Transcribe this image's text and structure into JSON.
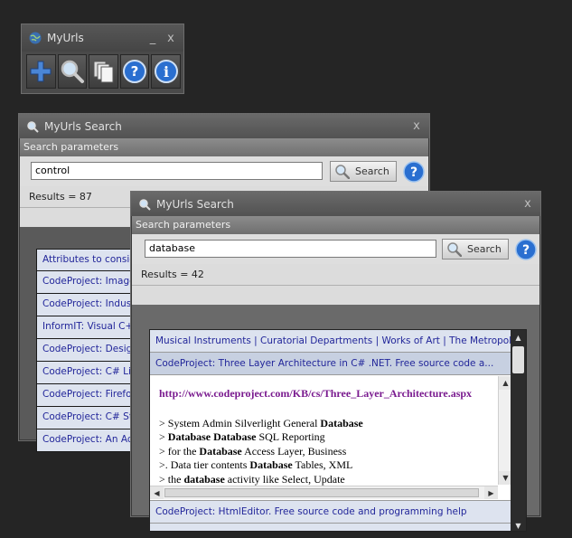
{
  "toolbar_window": {
    "title": "MyUrls",
    "minimize": "_",
    "close": "x",
    "buttons": [
      {
        "icon": "plus-icon"
      },
      {
        "icon": "search-icon"
      },
      {
        "icon": "copy-icon"
      },
      {
        "icon": "help-icon"
      },
      {
        "icon": "info-icon"
      }
    ]
  },
  "search_window_back": {
    "title": "MyUrls Search",
    "close": "x",
    "params_label": "Search parameters",
    "query": "control",
    "search_label": "Search",
    "results": "Results = 87",
    "items": [
      "Attributes to conside",
      "CodeProject: Image",
      "CodeProject: Indust",
      "InformIT: Visual C++",
      "CodeProject: Design",
      "CodeProject: C# Lis",
      "CodeProject: Firefox",
      "CodeProject: C# Sta",
      "CodeProject: An Aqu"
    ]
  },
  "search_window_front": {
    "title": "MyUrls Search",
    "close": "x",
    "params_label": "Search parameters",
    "query": "database",
    "search_label": "Search",
    "results": "Results = 42",
    "rows": {
      "first": "Musical Instruments | Curatorial Departments | Works of Art | The Metropolit...",
      "selected": "CodeProject: Three Layer Architecture in C# .NET. Free source code a...",
      "after": "CodeProject: HtmlEditor. Free source code and programming help"
    },
    "preview": {
      "url": "http://www.codeproject.com/KB/cs/Three_Layer_Architecture.aspx",
      "lines": [
        {
          "pre": "> System Admin Silverlight General ",
          "bold": "Database",
          "post": ""
        },
        {
          "pre": "> ",
          "bold": "Database Database",
          "post": " SQL Reporting"
        },
        {
          "pre": "> for the ",
          "bold": "Database",
          "post": " Access Layer, Business"
        },
        {
          "pre": ">. Data tier contents ",
          "bold": "Database",
          "post": " Tables, XML"
        },
        {
          "pre": "> the ",
          "bold": "database",
          "post": " activity like Select, Update"
        }
      ]
    }
  },
  "colors": {
    "link": "#22269a",
    "url": "#7a1b8f",
    "help": "#2a6fd0"
  }
}
